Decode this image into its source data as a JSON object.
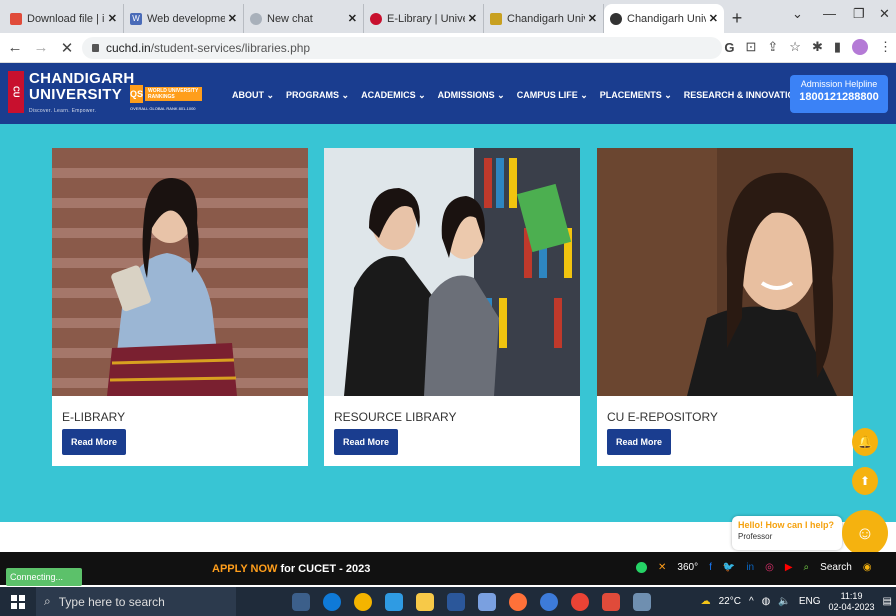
{
  "browser": {
    "tabs": [
      {
        "title": "Download file | iLo",
        "color": "#e04b3a"
      },
      {
        "title": "Web development",
        "color": "#4a6bb8"
      },
      {
        "title": "New chat",
        "color": "#a8b0ba"
      },
      {
        "title": "E-Library | Universit",
        "color": "#c8102e"
      },
      {
        "title": "Chandigarh Univer",
        "color": "#c8a020"
      },
      {
        "title": "Chandigarh Univer",
        "color": "#333333"
      }
    ],
    "url_host": "cuchd.in",
    "url_path": "/student-services/libraries.php"
  },
  "header": {
    "logo_line1": "CHANDIGARH",
    "logo_line2": "UNIVERSITY",
    "logo_tagline": "Discover. Learn. Empower.",
    "seal": "CU",
    "qs_mark": "QS",
    "qs_text": "WORLD UNIVERSITY RANKINGS",
    "qs_rank": "OVERALL GLOBAL RANK 801-1000",
    "nav": [
      "ABOUT ⌄",
      "PROGRAMS ⌄",
      "ACADEMICS ⌄",
      "ADMISSIONS ⌄",
      "CAMPUS LIFE ⌄",
      "PLACEMENTS ⌄",
      "RESEARCH & INNOVATION ⌄"
    ],
    "helpline_label": "Admission Helpline",
    "helpline_number": "1800121288800"
  },
  "cards": [
    {
      "title": "E-LIBRARY",
      "button": "Read More"
    },
    {
      "title": "RESOURCE LIBRARY",
      "button": "Read More"
    },
    {
      "title": "CU E-REPOSITORY",
      "button": "Read More"
    }
  ],
  "bottom": {
    "apply": "APPLY NOW",
    "apply_rest": " for CUCET - 2023",
    "tour": "360°",
    "search": "Search"
  },
  "chat": {
    "question": "Hello! How can I help?",
    "role": "Professor"
  },
  "status": "Connecting...",
  "taskbar": {
    "search_placeholder": "Type here to search",
    "weather": "22°C",
    "lang": "ENG",
    "time": "11:19",
    "date": "02-04-2023"
  }
}
